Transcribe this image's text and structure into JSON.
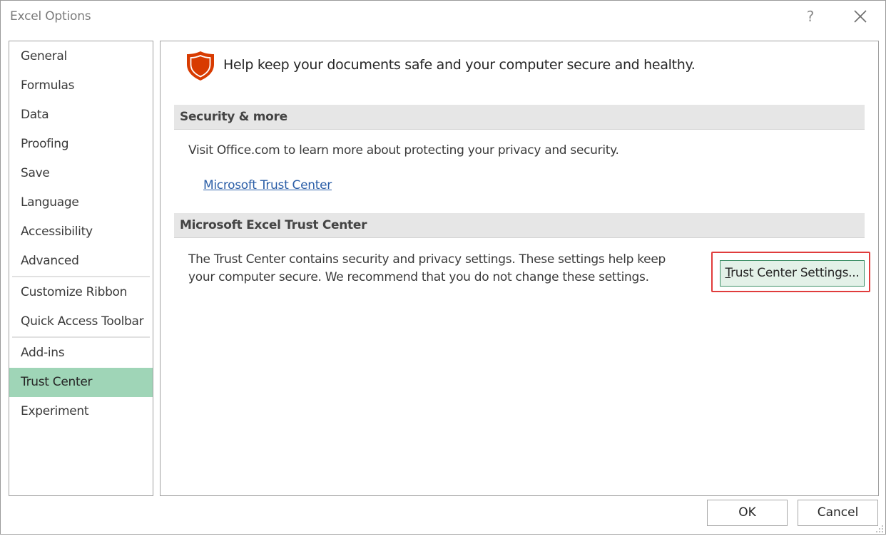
{
  "window": {
    "title": "Excel Options",
    "help_label": "?"
  },
  "sidebar": {
    "items": [
      {
        "label": "General"
      },
      {
        "label": "Formulas"
      },
      {
        "label": "Data"
      },
      {
        "label": "Proofing"
      },
      {
        "label": "Save"
      },
      {
        "label": "Language"
      },
      {
        "label": "Accessibility"
      },
      {
        "label": "Advanced"
      },
      {
        "label": "Customize Ribbon"
      },
      {
        "label": "Quick Access Toolbar"
      },
      {
        "label": "Add-ins"
      },
      {
        "label": "Trust Center"
      },
      {
        "label": "Experiment"
      }
    ],
    "selected": "Trust Center"
  },
  "main": {
    "intro": "Help keep your documents safe and your computer secure and healthy.",
    "security_section": {
      "header": "Security & more",
      "text": "Visit Office.com to learn more about protecting your privacy and security.",
      "link": "Microsoft Trust Center"
    },
    "trust_section": {
      "header": "Microsoft Excel Trust Center",
      "text": "The Trust Center contains security and privacy settings. These settings help keep your computer secure. We recommend that you do not change these settings.",
      "button_accel": "T",
      "button_rest": "rust Center Settings..."
    }
  },
  "footer": {
    "ok_label": "OK",
    "cancel_label": "Cancel"
  },
  "colors": {
    "selected_nav": "#9fd5b7",
    "highlight_border": "#e03c3c",
    "shield": "#d83b01",
    "link": "#2b5ea7"
  },
  "icons": [
    "help-icon",
    "close-icon",
    "shield-icon",
    "resize-grip-icon"
  ]
}
